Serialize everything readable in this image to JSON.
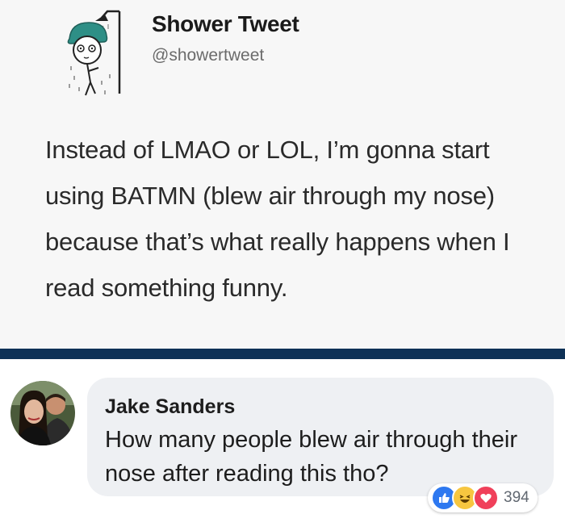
{
  "tweet": {
    "name": "Shower Tweet",
    "handle": "@showertweet",
    "text": "Instead of LMAO or LOL, I’m gonna start using BATMN (blew air through my nose) because that’s what really happens when I read something funny."
  },
  "comment": {
    "author": "Jake Sanders",
    "text": "How many people blew air through their nose after reading this tho?",
    "reactions": {
      "icons": [
        "like-icon",
        "haha-icon",
        "love-icon"
      ],
      "count": "394"
    }
  },
  "colors": {
    "divider": "#0e3156",
    "like": "#2d78f0",
    "haha": "#f7c640",
    "love": "#f0405a"
  }
}
